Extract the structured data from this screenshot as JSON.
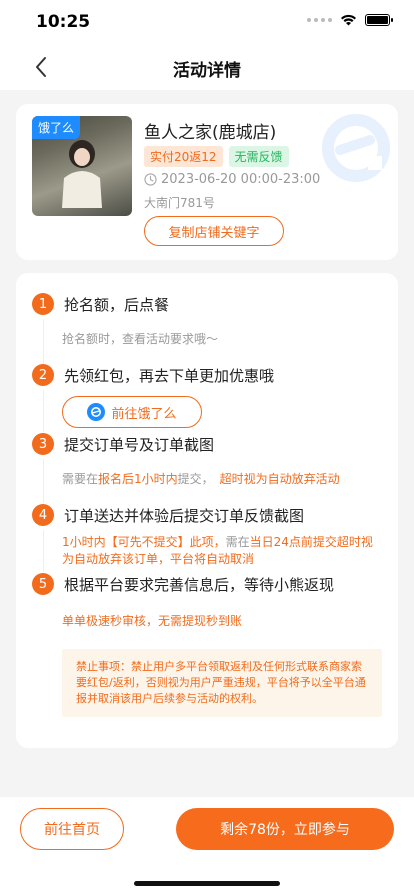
{
  "status_bar": {
    "time": "10:25"
  },
  "nav": {
    "title": "活动详情"
  },
  "shop": {
    "platform_tag": "饿了么",
    "name": "鱼人之家(鹿城店)",
    "tags": [
      "实付20返12",
      "无需反馈"
    ],
    "time": "2023-06-20 00:00-23:00",
    "address": "大南门781号",
    "copy_label": "复制店铺关键字"
  },
  "steps": [
    {
      "num": "1",
      "title": "抢名额，后点餐",
      "desc": "抢名额时，查看活动要求哦～"
    },
    {
      "num": "2",
      "title": "先领红包，再去下单更加优惠哦",
      "button": "前往饿了么"
    },
    {
      "num": "3",
      "title": "提交订单号及订单截图",
      "desc_parts": [
        "需要在",
        "报名后1小时内",
        "提交，",
        "超时视为自动放弃活动"
      ]
    },
    {
      "num": "4",
      "title": "订单送达并体验后提交订单反馈截图",
      "desc_line1_parts": [
        "1小时内【可先不提交】此项，",
        "需在",
        "当日24点前提交超时视"
      ],
      "desc_line2": "为自动放弃该订单，平台将自动取消"
    },
    {
      "num": "5",
      "title": "根据平台要求完善信息后，等待小熊返现",
      "desc": "单单极速秒审核，无需提现秒到账"
    }
  ],
  "notice": "禁止事项：禁止用户多平台领取返利及任何形式联系商家索要红包/返利，否则视为用户严重违规，平台将予以全平台通报并取消该用户后续参与活动的权利。",
  "bottom": {
    "home_label": "前往首页",
    "join_label": "剩余78份，立即参与"
  },
  "colors": {
    "accent": "#f26b1d",
    "brand_blue": "#1e8cff",
    "green": "#24b55b"
  }
}
